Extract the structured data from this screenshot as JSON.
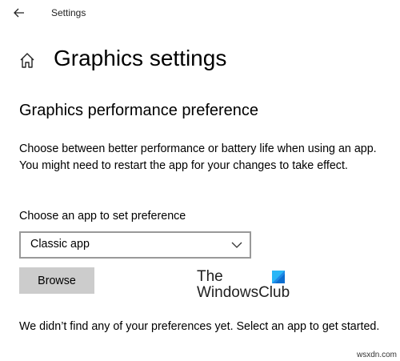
{
  "window": {
    "title": "Settings",
    "back_icon": "arrow-left-icon"
  },
  "header": {
    "home_icon": "home-icon",
    "page_title": "Graphics settings"
  },
  "section": {
    "heading": "Graphics performance preference",
    "description": "Choose between better performance or battery life when using an app. You might need to restart the app for your changes to take effect."
  },
  "app_select": {
    "label": "Choose an app to set preference",
    "selected": "Classic app",
    "chevron_icon": "chevron-down-icon"
  },
  "browse_button": {
    "label": "Browse"
  },
  "watermark": {
    "line1": "The",
    "line2": "WindowsClub",
    "logo_icon": "windows-club-logo-icon",
    "logo_colors": [
      "#1e88e5",
      "#0ea5e9",
      "#29b6f6"
    ]
  },
  "status": {
    "message": "We didn’t find any of your preferences yet. Select an app to get started."
  },
  "footer": {
    "mark": "wsxdn.com"
  }
}
